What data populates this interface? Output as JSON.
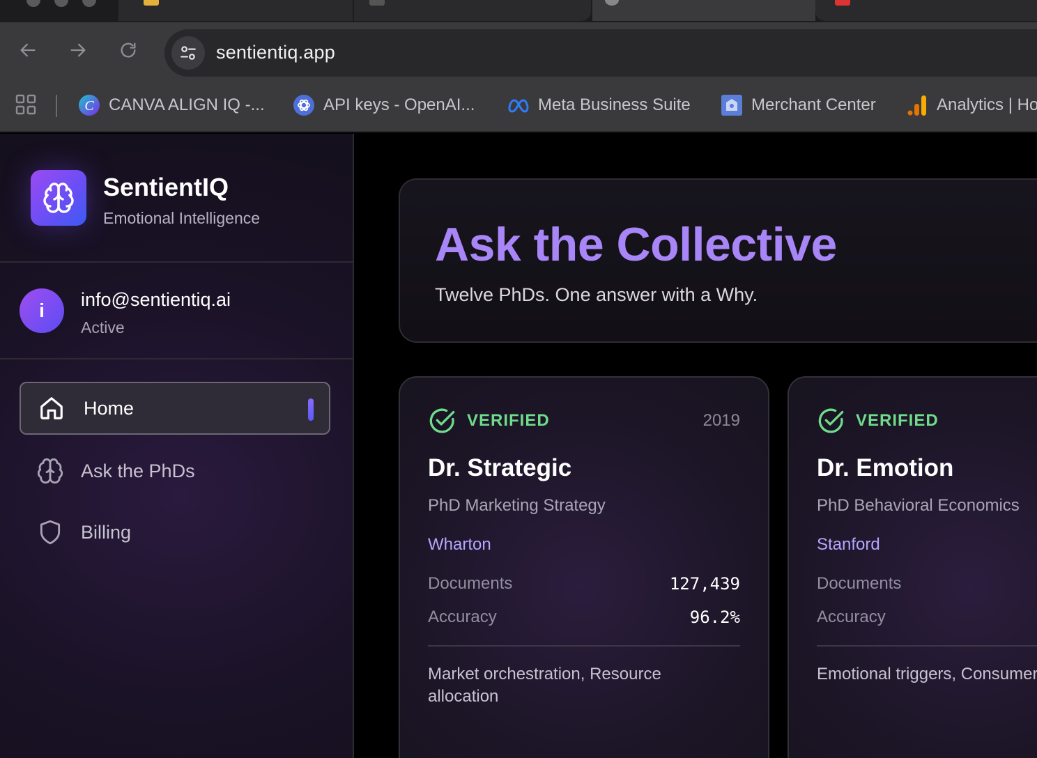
{
  "browser": {
    "url": "sentientiq.app",
    "bookmarks": [
      {
        "label": "CANVA ALIGN IQ -...",
        "icon": "canva-icon"
      },
      {
        "label": "API keys - OpenAI...",
        "icon": "openai-icon"
      },
      {
        "label": "Meta Business Suite",
        "icon": "meta-icon"
      },
      {
        "label": "Merchant Center",
        "icon": "merchant-center-icon"
      },
      {
        "label": "Analytics | Ho",
        "icon": "analytics-icon"
      }
    ]
  },
  "sidebar": {
    "brand_name": "SentientIQ",
    "brand_subtitle": "Emotional Intelligence",
    "user": {
      "avatar_letter": "i",
      "email": "info@sentientiq.ai",
      "status": "Active"
    },
    "nav": [
      {
        "label": "Home",
        "icon": "home-icon",
        "active": true
      },
      {
        "label": "Ask the PhDs",
        "icon": "brain-icon",
        "active": false
      },
      {
        "label": "Billing",
        "icon": "shield-icon",
        "active": false
      }
    ]
  },
  "hero": {
    "title": "Ask the Collective",
    "subtitle": "Twelve PhDs. One answer with a Why."
  },
  "cards": [
    {
      "verified_label": "VERIFIED",
      "year": "2019",
      "name": "Dr. Strategic",
      "degree": "PhD Marketing Strategy",
      "school": "Wharton",
      "documents_label": "Documents",
      "documents_value": "127,439",
      "accuracy_label": "Accuracy",
      "accuracy_value": "96.2%",
      "tags": "Market orchestration, Resource allocation"
    },
    {
      "verified_label": "VERIFIED",
      "name": "Dr. Emotion",
      "degree": "PhD Behavioral Economics",
      "school": "Stanford",
      "documents_label": "Documents",
      "accuracy_label": "Accuracy",
      "tags": "Emotional triggers, Consumer psychology"
    }
  ],
  "colors": {
    "accent": "#a886f7",
    "verified": "#6fdc8c",
    "school": "#b5a6ff",
    "logo_gradient_start": "#9b4bf2",
    "logo_gradient_end": "#3b5bf2"
  }
}
